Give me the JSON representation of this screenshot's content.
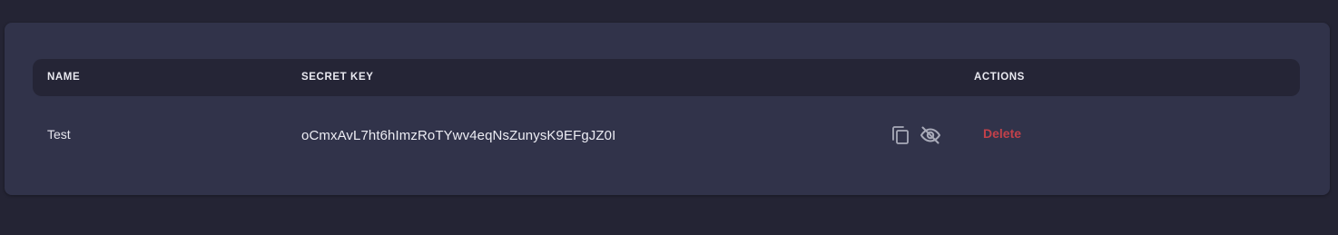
{
  "table": {
    "columns": {
      "name": "NAME",
      "secret_key": "SECRET KEY",
      "actions": "ACTIONS"
    },
    "rows": [
      {
        "name": "Test",
        "secret_key": "oCmxAvL7ht6hImzRoTYwv4eqNsZunysK9EFgJZ0I",
        "icons": [
          "copy-icon",
          "eye-off-icon"
        ],
        "delete_label": "Delete"
      }
    ]
  },
  "colors": {
    "page_background": "#242434",
    "card_background": "#31334a",
    "header_background": "#252536",
    "delete_text": "#c2414a",
    "icon": "#a9abb9"
  }
}
